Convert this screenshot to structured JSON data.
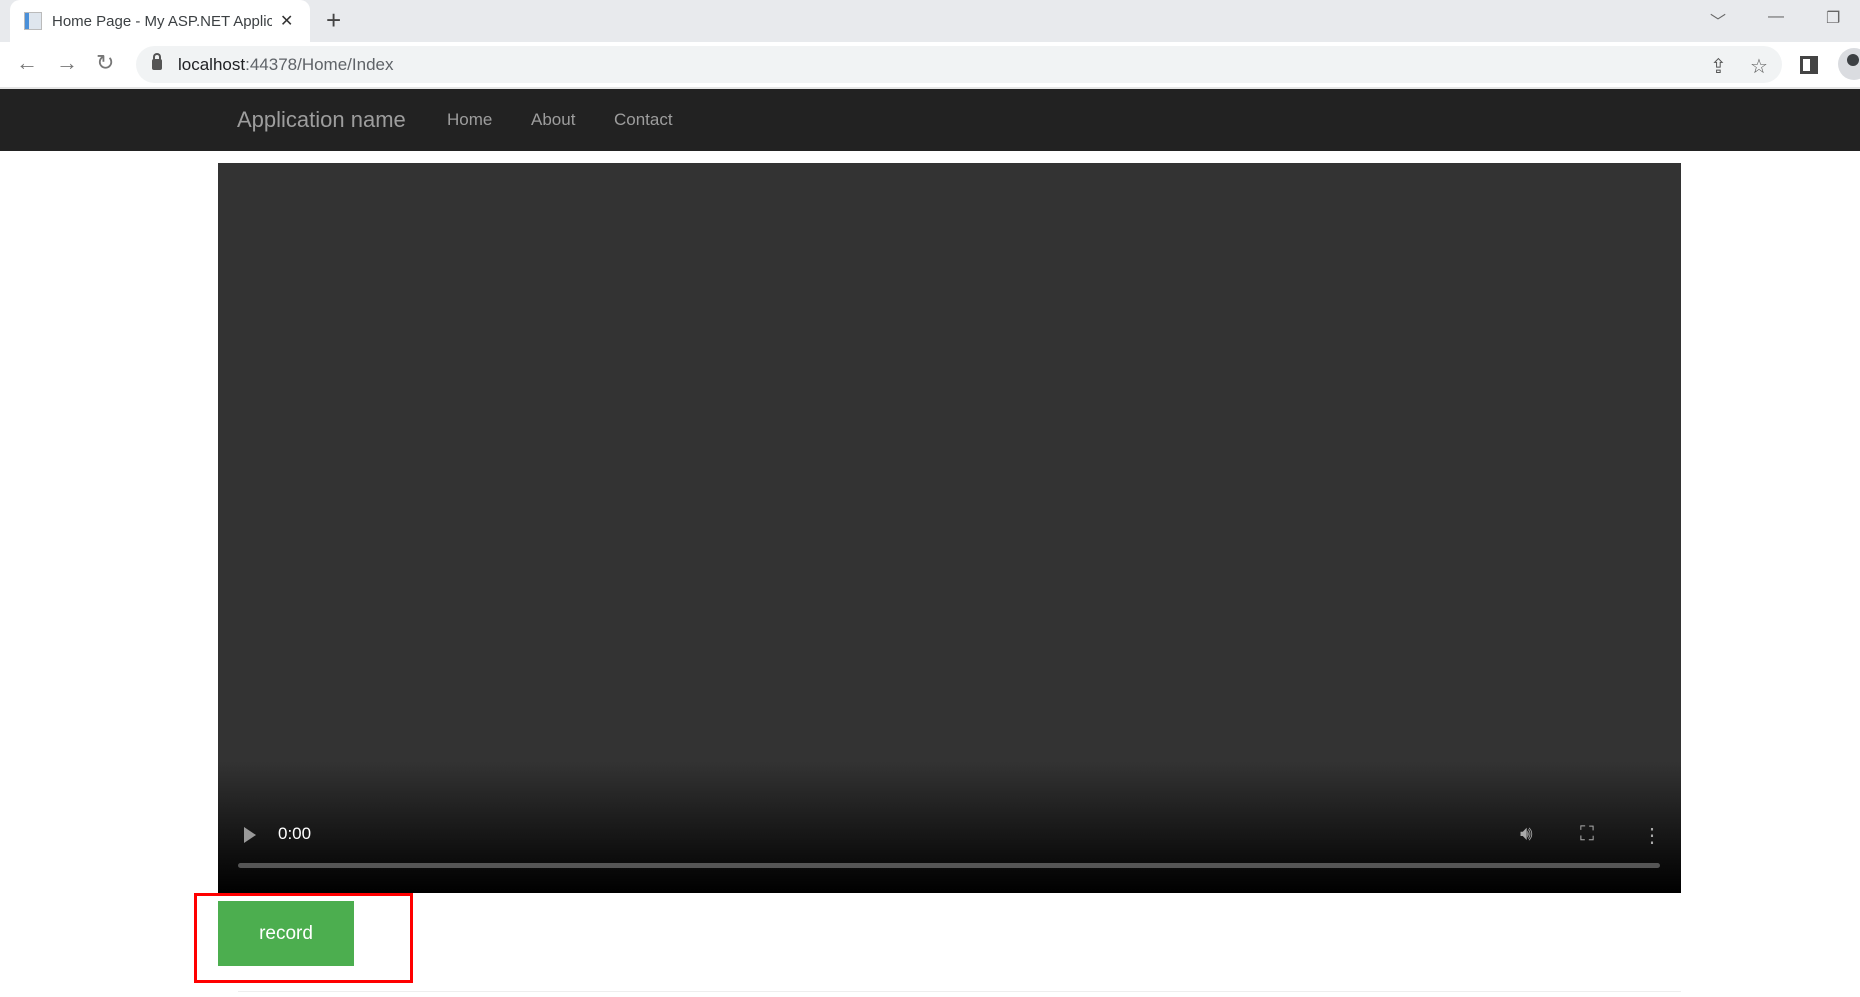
{
  "browser": {
    "tab_title": "Home Page - My ASP.NET Applic",
    "url_host": "localhost",
    "url_path": ":44378/Home/Index"
  },
  "navbar": {
    "brand": "Application name",
    "links": [
      "Home",
      "About",
      "Contact"
    ]
  },
  "video": {
    "time": "0:00",
    "progress": 0
  },
  "record_button": "record",
  "colors": {
    "navbar": "#222222",
    "record_button": "#4cae4f",
    "highlight": "#ff0000"
  }
}
